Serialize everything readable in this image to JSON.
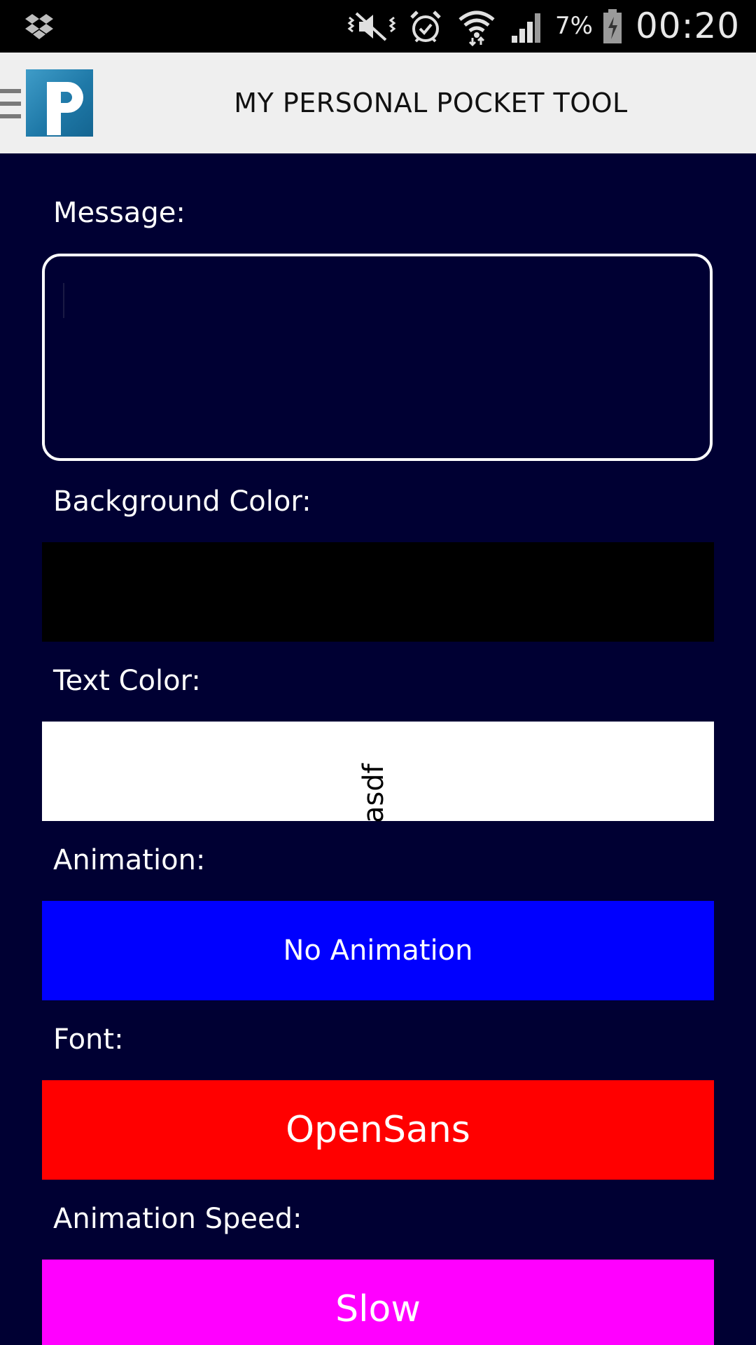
{
  "status_bar": {
    "battery_percent": "7%",
    "clock": "00:20",
    "icons": [
      "dropbox-icon",
      "mute-icon",
      "alarm-icon",
      "wifi-icon",
      "signal-icon",
      "battery-icon"
    ]
  },
  "header": {
    "title": "MY PERSONAL POCKET TOOL",
    "logo_letter": "P",
    "logo_colors": [
      "#3f9cc8",
      "#146591"
    ]
  },
  "form": {
    "message": {
      "label": "Message:",
      "value": ""
    },
    "background_color": {
      "label": "Background Color:",
      "value_color": "#000000"
    },
    "text_color": {
      "label": "Text Color:",
      "value_color": "#ffffff"
    },
    "animation": {
      "label": "Animation:",
      "value": "No Animation",
      "button_color": "#0000ff"
    },
    "font": {
      "label": "Font:",
      "value": "OpenSans",
      "button_color": "#ff0000"
    },
    "animation_speed": {
      "label": "Animation Speed:",
      "value": "Slow",
      "button_color": "#ff00ff"
    }
  },
  "preview": {
    "text": "asdf"
  },
  "colors": {
    "screen_background": "#000033",
    "header_background": "#efefef"
  }
}
